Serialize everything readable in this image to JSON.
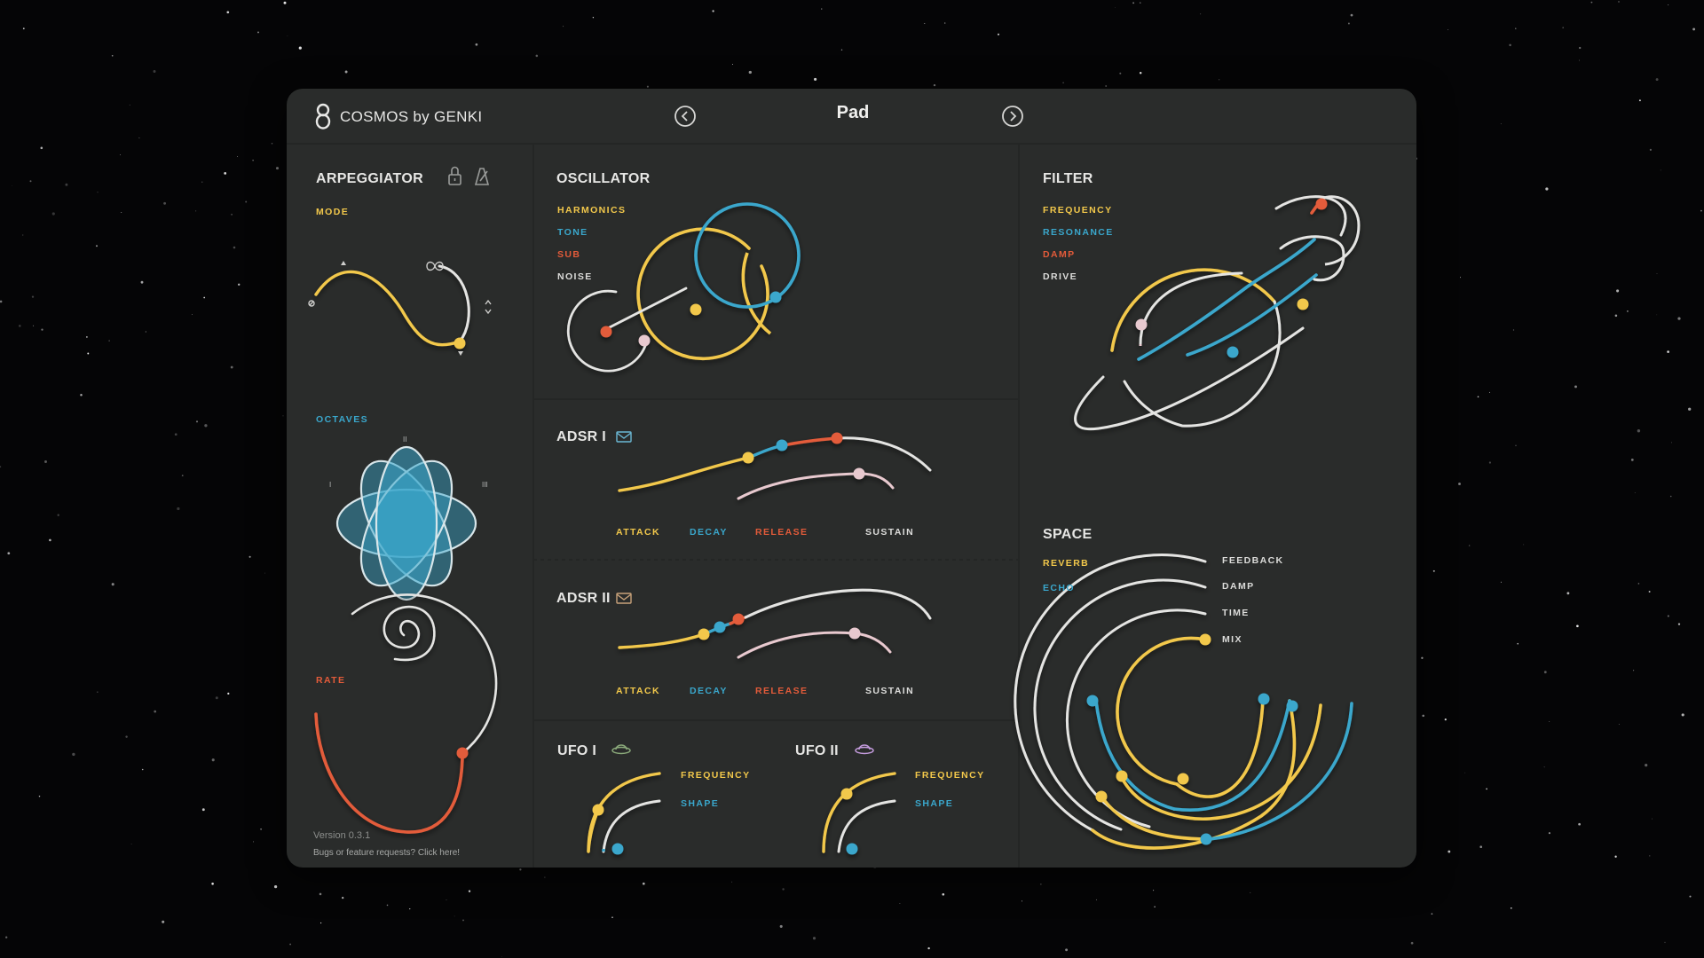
{
  "app": {
    "title_brand": "COSMOS by GENKI",
    "preset_name": "Pad",
    "prev_icon": "chevron-left-circle-icon",
    "next_icon": "chevron-right-circle-icon"
  },
  "arpeggiator": {
    "title": "ARPEGGIATOR",
    "lock_icon": "lock-icon",
    "metronome_icon": "metronome-icon",
    "mode_label": "MODE",
    "octaves_label": "OCTAVES",
    "octave_marks": [
      "I",
      "II",
      "III"
    ],
    "rate_label": "RATE"
  },
  "oscillator": {
    "title": "OSCILLATOR",
    "labels": [
      "HARMONICS",
      "TONE",
      "SUB",
      "NOISE"
    ]
  },
  "adsr1": {
    "title": "ADSR I",
    "labels": [
      "ATTACK",
      "DECAY",
      "RELEASE",
      "SUSTAIN"
    ]
  },
  "adsr2": {
    "title": "ADSR II",
    "labels": [
      "ATTACK",
      "DECAY",
      "RELEASE",
      "SUSTAIN"
    ]
  },
  "ufo1": {
    "title": "UFO I",
    "labels": [
      "FREQUENCY",
      "SHAPE"
    ]
  },
  "ufo2": {
    "title": "UFO II",
    "labels": [
      "FREQUENCY",
      "SHAPE"
    ]
  },
  "filter": {
    "title": "FILTER",
    "labels": [
      "FREQUENCY",
      "RESONANCE",
      "DAMP",
      "DRIVE"
    ]
  },
  "space": {
    "title": "SPACE",
    "left_labels": [
      "REVERB",
      "ECHO"
    ],
    "right_labels": [
      "FEEDBACK",
      "DAMP",
      "TIME",
      "MIX"
    ]
  },
  "footer": {
    "version": "Version 0.3.1",
    "bugs_link": "Bugs or feature requests? Click here!"
  },
  "colors": {
    "yellow": "#f2c84b",
    "blue": "#3aa7cc",
    "red": "#e35b3a",
    "white": "#e4e4e2",
    "pink": "#e8c9cf",
    "panel": "#2a2c2b"
  }
}
